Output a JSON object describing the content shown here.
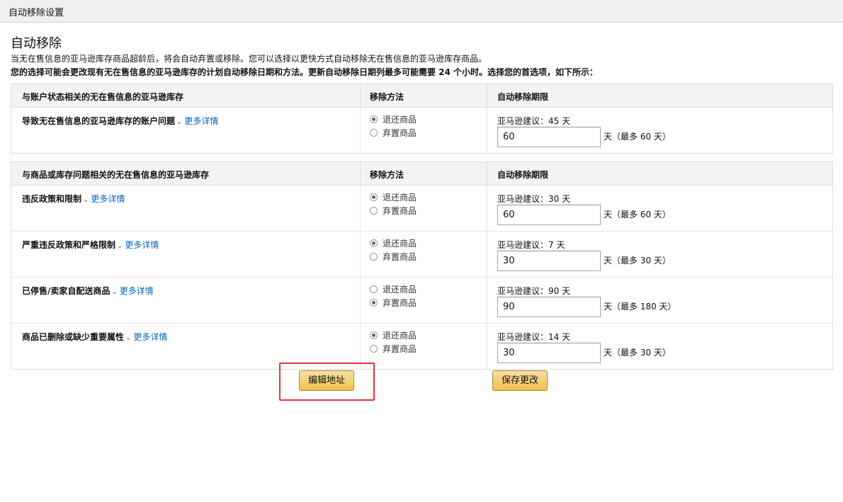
{
  "page": {
    "window_title": "自动移除设置",
    "section_title": "自动移除",
    "description": "当无在售信息的亚马逊库存商品超龄后，将会自动弃置或移除。您可以选择以更快方式自动移除无在售信息的亚马逊库存商品。",
    "notice": "您的选择可能会更改现有无在售信息的亚马逊库存的计划自动移除日期和方法。更新自动移除日期列最多可能需要 24 个小时。选择您的首选项，如下所示："
  },
  "option_labels": {
    "return": "退还商品",
    "dispose": "弃置商品"
  },
  "more_details": "更多详情",
  "table1": {
    "headers": [
      "与账户状态相关的无在售信息的亚马逊库存",
      "移除方法",
      "自动移除期限"
    ],
    "rows": [
      {
        "label": "导致无在售信息的亚马逊库存的账户问题",
        "selected": "return",
        "recommendation": "亚马逊建议：45 天",
        "value": "60",
        "max": "天（最多 60 天）"
      }
    ]
  },
  "table2": {
    "headers": [
      "与商品或库存问题相关的无在售信息的亚马逊库存",
      "移除方法",
      "自动移除期限"
    ],
    "rows": [
      {
        "label": "违反政策和限制",
        "selected": "return",
        "recommendation": "亚马逊建议：30 天",
        "value": "60",
        "max": "天（最多 60 天）"
      },
      {
        "label": "严重违反政策和严格限制",
        "selected": "return",
        "recommendation": "亚马逊建议：7 天",
        "value": "30",
        "max": "天（最多 30 天）"
      },
      {
        "label": "已停售/卖家自配送商品",
        "selected": "dispose",
        "recommendation": "亚马逊建议：90 天",
        "value": "90",
        "max": "天（最多 180 天）"
      },
      {
        "label": "商品已删除或缺少重要属性",
        "selected": "return",
        "recommendation": "亚马逊建议：14 天",
        "value": "30",
        "max": "天（最多 30 天）"
      }
    ]
  },
  "buttons": {
    "edit_address": "编辑地址",
    "save_changes": "保存更改"
  },
  "colors": {
    "link": "#0066c0",
    "button_top": "#f7dfa5",
    "button_bottom": "#f0c14b",
    "highlight": "#e8323c"
  }
}
